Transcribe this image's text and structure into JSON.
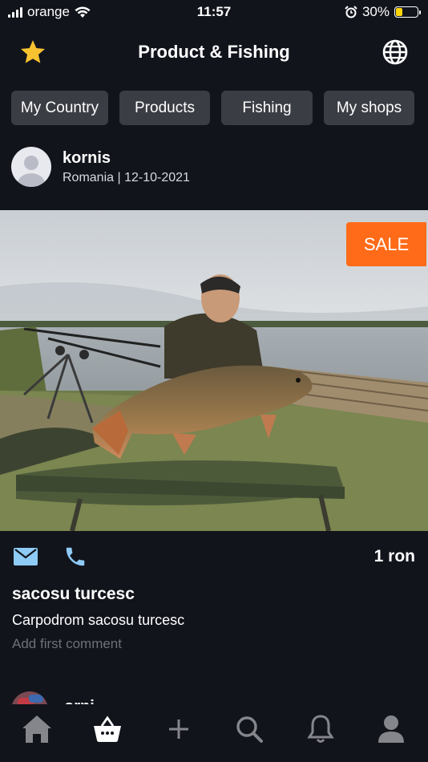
{
  "status": {
    "carrier": "orange",
    "time": "11:57",
    "battery": "30%",
    "battery_level": 0.3
  },
  "header": {
    "title": "Product & Fishing",
    "left_icon": "star-icon",
    "right_icon": "globe-icon"
  },
  "tabs": [
    {
      "label": "My Country"
    },
    {
      "label": "Products"
    },
    {
      "label": "Fishing"
    },
    {
      "label": "My shops"
    }
  ],
  "post": {
    "author": "kornis",
    "meta": "Romania | 12-10-2021",
    "badge": "SALE",
    "price": "1 ron",
    "title": "sacosu turcesc",
    "description": "Carpodrom sacosu turcesc",
    "comment_placeholder": "Add first comment"
  },
  "next_post": {
    "author": "orni"
  },
  "colors": {
    "background": "#12141c",
    "accent": "#ff6b18",
    "star": "#f7c230",
    "action_icons": "#8ecbf5",
    "tab_bg": "#3b3d44"
  },
  "bottom_nav": [
    "home-icon",
    "basket-icon",
    "plus-icon",
    "search-icon",
    "bell-icon",
    "profile-icon"
  ]
}
